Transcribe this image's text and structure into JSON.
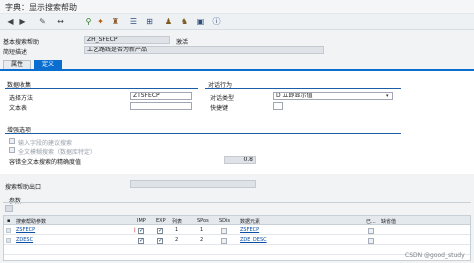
{
  "window": {
    "title": "字典：显示搜索帮助"
  },
  "toolbar": {
    "icons": [
      "back-icon",
      "forward-icon",
      "display-change-icon",
      "other-object-icon",
      "check-icon",
      "activate-icon",
      "where-used-icon",
      "object-list-icon",
      "hierarchy-icon",
      "navigation-icon",
      "org-icon",
      "test-icon",
      "info-icon"
    ]
  },
  "header": {
    "search_help_label": "基本搜索帮助",
    "search_help_value": "ZH_SFECP",
    "status_label": "激活",
    "short_desc_label": "简短描述",
    "short_desc_value": "工艺路线是否为新产品"
  },
  "tabs": [
    {
      "label": "属性",
      "active": false
    },
    {
      "label": "定义",
      "active": true
    }
  ],
  "data_collection": {
    "title": "数据收集",
    "selection_method_label": "选择方法",
    "selection_method_value": "ZTSFECP",
    "text_table_label": "文本表"
  },
  "dialog_behavior": {
    "title": "对话行为",
    "dialog_type_label": "对话类型",
    "dialog_type_value": "D 立即显示值",
    "hotkey_label": "快捷键"
  },
  "enhanced_options": {
    "title": "增强选项",
    "option1_label": "输入字段的建议搜索",
    "option2_label": "全文模糊搜索（数据库特定）",
    "option3_label": "容错全文本搜索的精确度值",
    "option3_value": "0.8"
  },
  "exit": {
    "label": "搜索帮助出口"
  },
  "params": {
    "section_title": "参数",
    "headers": [
      "搜索帮助参数",
      "IMP",
      "EXP",
      "列表",
      "SPos",
      "SDis",
      "数据元素",
      "已...",
      "缺省值"
    ],
    "rows": [
      {
        "name": "ZSFECP",
        "imp": true,
        "exp": true,
        "list": "1",
        "spos": "1",
        "sdis": false,
        "element": "ZSFECP"
      },
      {
        "name": "ZDESC",
        "imp": true,
        "exp": true,
        "list": "2",
        "spos": "2",
        "sdis": false,
        "element": "ZDE_DESC"
      }
    ]
  },
  "watermark": "CSDN @good_study"
}
